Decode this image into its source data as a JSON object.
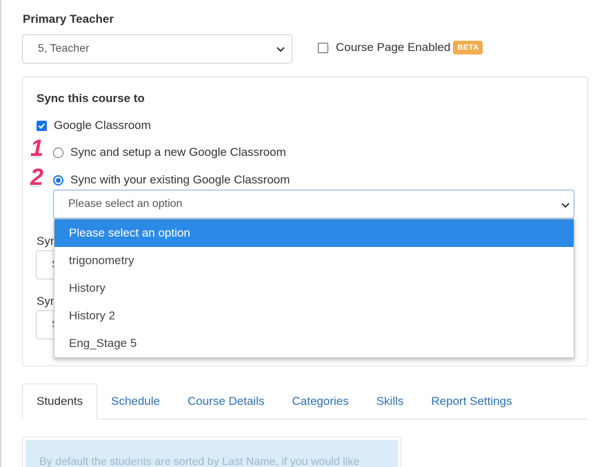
{
  "primary_teacher": {
    "label": "Primary Teacher",
    "selected": "5, Teacher"
  },
  "course_page": {
    "label": "Course Page Enabled",
    "badge": "BETA",
    "checked": false
  },
  "sync": {
    "title": "Sync this course to",
    "google_classroom": {
      "label": "Google Classroom",
      "checked": true
    },
    "option_new": {
      "number": "1",
      "label": "Sync and setup a new Google Classroom",
      "selected": false
    },
    "option_existing": {
      "number": "2",
      "label": "Sync with your existing Google Classroom",
      "selected": true
    },
    "classroom_select": {
      "value": "Please select an option",
      "options": [
        "Please select an option",
        "trigonometry",
        "History",
        "History 2",
        "Eng_Stage 5"
      ],
      "highlighted": "Please select an option"
    },
    "hidden_fields": [
      {
        "label_visible": "Syn",
        "value_visible": "S"
      },
      {
        "label_visible": "Syn",
        "value_visible": "S"
      }
    ]
  },
  "tabs": [
    {
      "label": "Students",
      "active": true
    },
    {
      "label": "Schedule",
      "active": false
    },
    {
      "label": "Course Details",
      "active": false
    },
    {
      "label": "Categories",
      "active": false
    },
    {
      "label": "Skills",
      "active": false
    },
    {
      "label": "Report Settings",
      "active": false
    }
  ],
  "info_text": "By default the students are sorted by Last Name, if you would like",
  "colors": {
    "accent": "#1a73e8",
    "highlight": "#2b8ae6",
    "beta_badge": "#f0ad4e",
    "annotation": "#e8316a",
    "link": "#2d6fb5"
  }
}
